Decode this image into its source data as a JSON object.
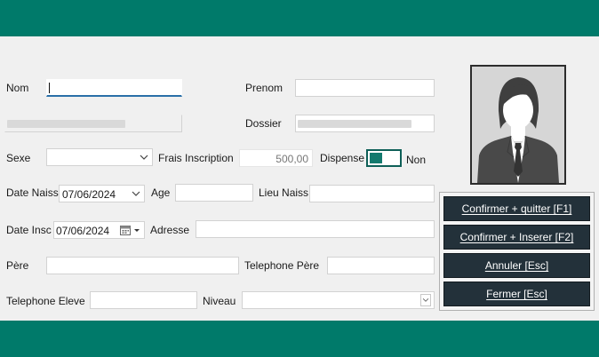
{
  "form": {
    "nom_label": "Nom",
    "prenom_label": "Prenom",
    "dossier_label": "Dossier",
    "sexe_label": "Sexe",
    "frais_label": "Frais Inscription",
    "frais_value": "500,00",
    "dispense_label": "Dispense",
    "dispense_state": "Non",
    "date_naiss_label": "Date Naiss",
    "date_naiss_value": "07/06/2024",
    "age_label": "Age",
    "lieu_naiss_label": "Lieu Naiss",
    "date_insc_label": "Date Insc",
    "date_insc_value": "07/06/2024",
    "adresse_label": "Adresse",
    "pere_label": "Père",
    "telephone_pere_label": "Telephone Père",
    "telephone_eleve_label": "Telephone Eleve",
    "niveau_label": "Niveau"
  },
  "buttons": {
    "confirm_quit": "Confirmer + quitter [F1]",
    "confirm_insert": "Confirmer + Inserer [F2]",
    "cancel": "Annuler [Esc]",
    "close": "Fermer [Esc]"
  },
  "icons": {
    "photo": "person-silhouette-icon",
    "dropdown": "chevron-down-icon",
    "calendar": "calendar-icon"
  },
  "colors": {
    "band": "#007a6a",
    "toggle": "#137a6e",
    "button": "#23313a",
    "focus": "#2a6fa8"
  }
}
